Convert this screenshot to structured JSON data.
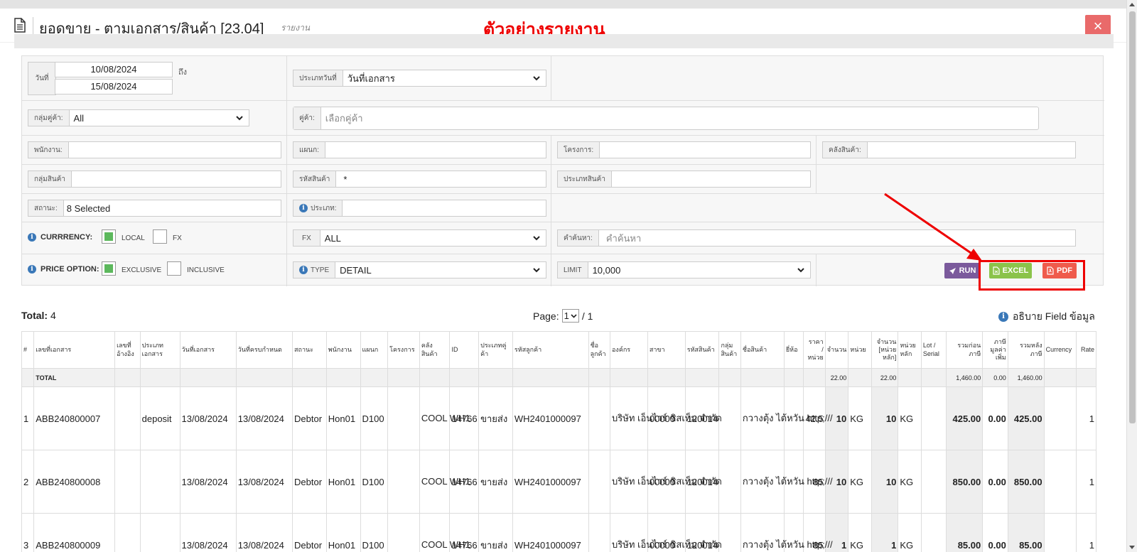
{
  "header": {
    "title": "ยอดขาย - ตามเอกสาร/สินค้า [23.04]",
    "subtitle": "รายงาน",
    "sample_label": "ตัวอย่างรายงาน",
    "close_label": "×"
  },
  "filters": {
    "date_label": "วันที่",
    "date_from": "10/08/2024",
    "date_to_label": "ถึง",
    "date_to": "15/08/2024",
    "date_type_label": "ประเภทวันที่",
    "date_type_value": "วันที่เอกสาร",
    "customer_group_label": "กลุ่มคู่ค้า:",
    "customer_group_value": "All",
    "customer_label": "คู่ค้า:",
    "customer_placeholder": "เลือกคู่ค้า",
    "employee_label": "พนักงาน:",
    "department_label": "แผนก:",
    "project_label": "โครงการ:",
    "warehouse_label": "คลังสินค้า:",
    "product_group_label": "กลุ่มสินค้า",
    "product_code_label": "รหัสสินค้า",
    "product_code_value": "*",
    "product_type_label": "ประเภทสินค้า",
    "status_label": "สถานะ:",
    "status_value": "8 Selected",
    "type_label": "ประเภท:",
    "currency_label": "CURRRENCY:",
    "local_label": "LOCAL",
    "fx_label": "FX",
    "fx_select_label": "FX",
    "fx_select_value": "ALL",
    "keyword_label": "คำค้นหา:",
    "keyword_placeholder": "คำค้นหา",
    "price_option_label": "PRICE OPTION:",
    "exclusive_label": "EXCLUSIVE",
    "inclusive_label": "INCLUSIVE",
    "type2_label": "TYPE",
    "type2_value": "DETAIL",
    "limit_label": "LIMIT",
    "limit_value": "10,000"
  },
  "buttons": {
    "run": "RUN",
    "excel": "EXCEL",
    "pdf": "PDF"
  },
  "summary": {
    "total_label": "Total:",
    "total_value": "4",
    "page_label": "Page:",
    "page_value": "1",
    "page_total": "/ 1",
    "field_info": "อธิบาย Field ข้อมูล"
  },
  "table": {
    "columns": [
      "#",
      "เลขที่เอกสาร",
      "เลขที่ อ้างอิง",
      "ประเภท เอกสาร",
      "วันที่เอกสาร",
      "วันที่ครบกำหนด",
      "สถานะ",
      "พนักงาน",
      "แผนก",
      "โครงการ",
      "คลัง สินค้า",
      "ID",
      "ประเภทคู่ ค้า",
      "รหัสลูกค้า",
      "ชื่อ ลูกค้า",
      "องค์กร",
      "สาขา",
      "รหัสสินค้า",
      "กลุ่ม สินค้า",
      "ชื่อสินค้า",
      "ยี่ห้อ",
      "ราคา / หน่วย",
      "จำนวน",
      "หน่วย",
      "จำนวน [หน่วย หลัก]",
      "หน่วย หลัก",
      "Lot / Serial",
      "รวมก่อน ภาษี",
      "ภาษี มูลค่า เพิ่ม",
      "รวมหลัง ภาษี",
      "Currency",
      "Rate"
    ],
    "total_row": {
      "label": "TOTAL",
      "qty": "22.00",
      "qty_main": "22.00",
      "before_tax": "1,460.00",
      "vat": "0.00",
      "after_tax": "1,460.00"
    },
    "rows": [
      {
        "no": "1",
        "doc": "ABB240800007",
        "ref": "",
        "doc_type": "deposit",
        "doc_date": "13/08/2024",
        "due_date": "13/08/2024",
        "status": "Debtor",
        "employee": "Hon01",
        "dept": "D100",
        "project": "",
        "warehouse": "COOL WH1",
        "id": "14766",
        "partner_type": "ขายส่ง",
        "customer_code": "WH2401000097",
        "customer_name": "",
        "org": "บริษัท เอ็นไวร์ ซิสเท็ม จำกัด",
        "branch": "00000",
        "product_code": "120014",
        "product_group": "",
        "product_name": "กวางตุ้ง ไต้หวัน http;///",
        "brand": "",
        "price": "42.5",
        "qty": "10",
        "unit": "KG",
        "qty_main": "10",
        "unit_main": "KG",
        "lot": "",
        "before_tax": "425.00",
        "vat": "0.00",
        "after_tax": "425.00",
        "currency": "",
        "rate": "1"
      },
      {
        "no": "2",
        "doc": "ABB240800008",
        "ref": "",
        "doc_type": "",
        "doc_date": "13/08/2024",
        "due_date": "13/08/2024",
        "status": "Debtor",
        "employee": "Hon01",
        "dept": "D100",
        "project": "",
        "warehouse": "COOL WH1",
        "id": "14766",
        "partner_type": "ขายส่ง",
        "customer_code": "WH2401000097",
        "customer_name": "",
        "org": "บริษัท เอ็นไวร์ ซิสเท็ม จำกัด",
        "branch": "00000",
        "product_code": "120014",
        "product_group": "",
        "product_name": "กวางตุ้ง ไต้หวัน http;///",
        "brand": "",
        "price": "85",
        "qty": "10",
        "unit": "KG",
        "qty_main": "10",
        "unit_main": "KG",
        "lot": "",
        "before_tax": "850.00",
        "vat": "0.00",
        "after_tax": "850.00",
        "currency": "",
        "rate": "1"
      },
      {
        "no": "3",
        "doc": "ABB240800009",
        "ref": "",
        "doc_type": "",
        "doc_date": "13/08/2024",
        "due_date": "13/08/2024",
        "status": "Debtor",
        "employee": "Hon01",
        "dept": "D100",
        "project": "",
        "warehouse": "COOL WH1",
        "id": "14766",
        "partner_type": "ขายส่ง",
        "customer_code": "WH2401000097",
        "customer_name": "",
        "org": "บริษัท เอ็นไวร์ ซิสเท็ม จำกัด",
        "branch": "00000",
        "product_code": "120014",
        "product_group": "",
        "product_name": "กวางตุ้ง ไต้หวัน http;///",
        "brand": "",
        "price": "85",
        "qty": "1",
        "unit": "KG",
        "qty_main": "1",
        "unit_main": "KG",
        "lot": "",
        "before_tax": "85.00",
        "vat": "0.00",
        "after_tax": "85.00",
        "currency": "",
        "rate": "1"
      }
    ]
  },
  "colors": {
    "accent_red": "#e00000",
    "run": "#7b5a9c",
    "excel": "#8bc34a",
    "pdf": "#ef5b4c",
    "info": "#3a78b8"
  }
}
